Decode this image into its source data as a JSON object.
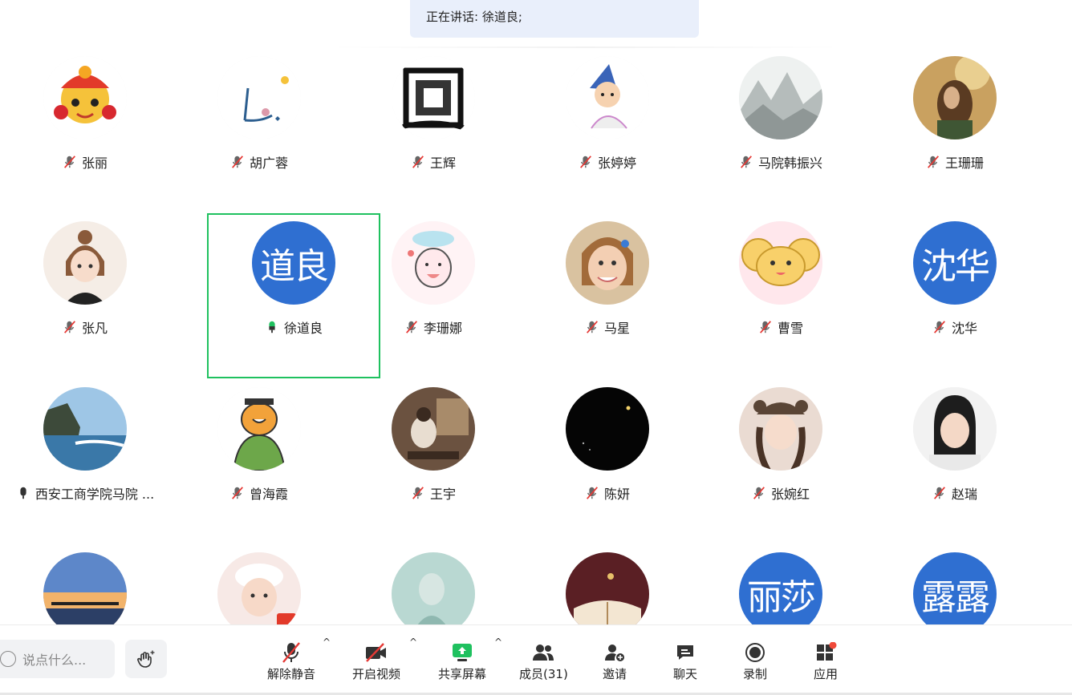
{
  "speaking": {
    "text": "正在讲话: 徐道良;"
  },
  "participants": [
    {
      "name": "张丽",
      "muted": true,
      "avatar": "opera-mask-avatar"
    },
    {
      "name": "胡广蓉",
      "muted": true,
      "avatar": "sketch-avatar"
    },
    {
      "name": "王辉",
      "muted": true,
      "avatar": "calligraphy-avatar"
    },
    {
      "name": "张婷婷",
      "muted": true,
      "avatar": "cartoon-kid-avatar"
    },
    {
      "name": "马院韩振兴",
      "muted": true,
      "avatar": "ink-landscape-avatar"
    },
    {
      "name": "王珊珊",
      "muted": true,
      "avatar": "photo-avatar"
    },
    {
      "name": "张凡",
      "muted": true,
      "avatar": "cartoon-girl-avatar"
    },
    {
      "name": "徐道良",
      "muted": false,
      "speaking": true,
      "avatar_text": "道良",
      "avatar_color": "#2f6fd1"
    },
    {
      "name": "李珊娜",
      "muted": true,
      "avatar": "cloud-character-avatar"
    },
    {
      "name": "马星",
      "muted": true,
      "avatar": "child-photo-avatar"
    },
    {
      "name": "曹雪",
      "muted": true,
      "avatar": "yellow-mouse-avatar"
    },
    {
      "name": "沈华",
      "muted": true,
      "avatar_text": "沈华",
      "avatar_color": "#2f6fd1"
    },
    {
      "name": "西安工商学院马院 ...",
      "muted": false,
      "avatar": "coast-photo-avatar"
    },
    {
      "name": "曾海霞",
      "muted": true,
      "avatar": "tiger-cartoon-avatar"
    },
    {
      "name": "王宇",
      "muted": true,
      "avatar": "room-photo-avatar"
    },
    {
      "name": "陈妍",
      "muted": true,
      "avatar": "dark-sky-avatar"
    },
    {
      "name": "张婉红",
      "muted": true,
      "avatar": "girl-hat-photo-avatar"
    },
    {
      "name": "赵瑞",
      "muted": true,
      "avatar": "girl-photo-avatar"
    },
    {
      "name": "",
      "muted": true,
      "avatar": "sunset-pier-avatar"
    },
    {
      "name": "",
      "muted": true,
      "avatar": "baby-photo-avatar"
    },
    {
      "name": "",
      "muted": true,
      "avatar": "teal-portrait-avatar"
    },
    {
      "name": "",
      "muted": true,
      "avatar": "book-photo-avatar"
    },
    {
      "name": "",
      "muted": true,
      "avatar_text": "丽莎",
      "avatar_color": "#2f6fd1"
    },
    {
      "name": "",
      "muted": true,
      "avatar_text": "露露",
      "avatar_color": "#2f6fd1"
    }
  ],
  "toolbar": {
    "chat_placeholder": "说点什么...",
    "unmute": "解除静音",
    "start_video": "开启视频",
    "share_screen": "共享屏幕",
    "members": "成员(31)",
    "invite": "邀请",
    "chat": "聊天",
    "record": "录制",
    "apps": "应用",
    "accent_color": "#1fc15f",
    "alert_color": "#f04a3a"
  }
}
